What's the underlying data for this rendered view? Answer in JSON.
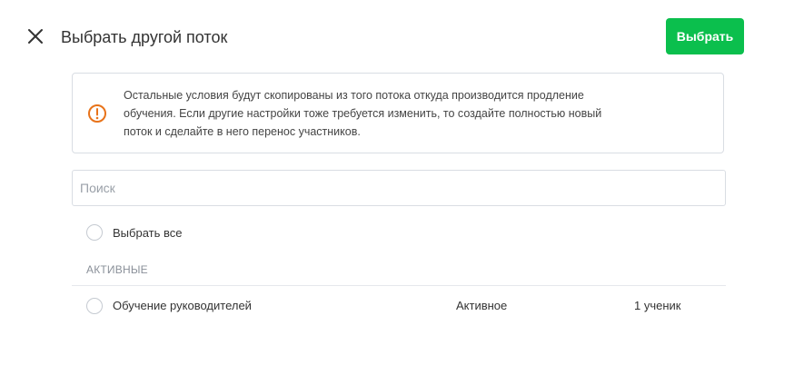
{
  "header": {
    "title": "Выбрать другой поток",
    "select_button_label": "Выбрать",
    "close_icon": "close-icon"
  },
  "notice": {
    "icon": "warning-circle-icon",
    "icon_color": "#e8731a",
    "text_line1": "Остальные условия будут скопированы из того потока откуда производится продление",
    "text_line2": "обучения. Если другие настройки тоже требуется изменить, то создайте полностью новый",
    "text_line3": "поток и сделайте в него перенос участников."
  },
  "search": {
    "placeholder": "Поиск",
    "value": ""
  },
  "select_all": {
    "label": "Выбрать все",
    "checked": false
  },
  "section": {
    "label": "АКТИВНЫЕ"
  },
  "streams": [
    {
      "name": "Обучение руководителей",
      "status": "Активное",
      "participants": "1 ученик",
      "checked": false
    }
  ],
  "colors": {
    "accent": "#0bbf4d",
    "border": "#d9dde3",
    "warning": "#e8731a"
  }
}
